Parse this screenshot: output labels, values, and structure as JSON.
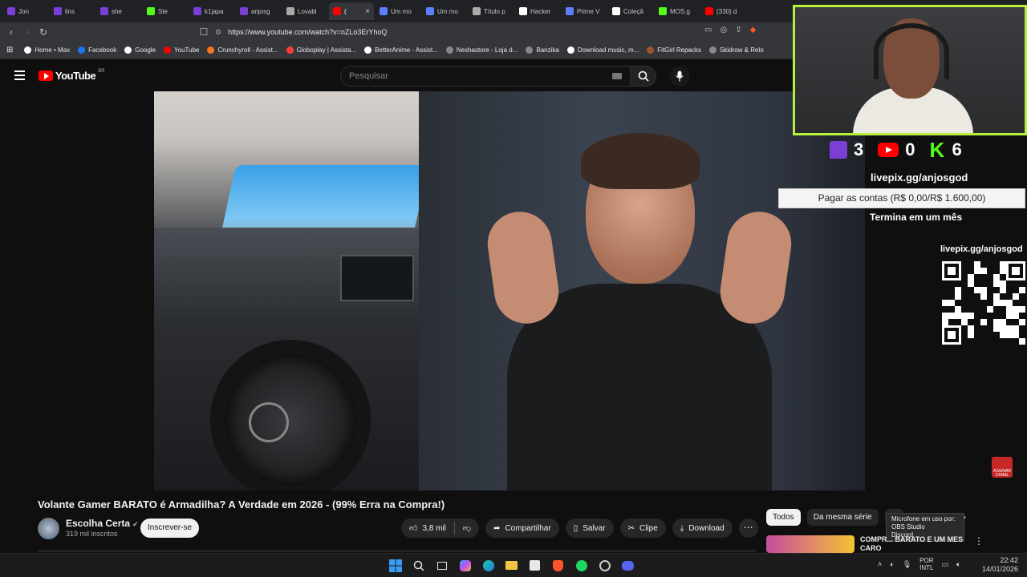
{
  "browser": {
    "tabs": [
      {
        "label": "Jon",
        "color": "#7b3fd6",
        "active": false
      },
      {
        "label": "lins",
        "color": "#7b3fd6",
        "active": false
      },
      {
        "label": "she",
        "color": "#7b3fd6",
        "active": false
      },
      {
        "label": "Ste",
        "color": "#53fc18",
        "active": false
      },
      {
        "label": "k1japa",
        "color": "#7b3fd6",
        "active": false
      },
      {
        "label": "anjosg",
        "color": "#7b3fd6",
        "active": false
      },
      {
        "label": "Lovabl",
        "color": "#aaaaaa",
        "active": false
      },
      {
        "label": "(",
        "color": "#ff0000",
        "active": true
      },
      {
        "label": "Um mo",
        "color": "#5b7fff",
        "active": false
      },
      {
        "label": "Um mo",
        "color": "#5b7fff",
        "active": false
      },
      {
        "label": "Título p",
        "color": "#aaaaaa",
        "active": false
      },
      {
        "label": "Hacker",
        "color": "#ffffff",
        "active": false
      },
      {
        "label": "Prime V",
        "color": "#5b7fff",
        "active": false
      },
      {
        "label": "Coleçã",
        "color": "#ffffff",
        "active": false
      },
      {
        "label": "MOS.g",
        "color": "#53fc18",
        "active": false
      },
      {
        "label": "(330) d",
        "color": "#ff0000",
        "active": false
      }
    ],
    "url": "https://www.youtube.com/watch?v=nZLo3ErYhoQ",
    "bookmarks": [
      {
        "label": "Home • Max",
        "color": "#ffffff"
      },
      {
        "label": "Facebook",
        "color": "#1877f2"
      },
      {
        "label": "Google",
        "color": "#ffffff"
      },
      {
        "label": "YouTube",
        "color": "#ff0000"
      },
      {
        "label": "Crunchyroll - Assist...",
        "color": "#f47521"
      },
      {
        "label": "Globoplay | Assista...",
        "color": "#ff3b3b"
      },
      {
        "label": "BetterAnime - Assist...",
        "color": "#ffffff"
      },
      {
        "label": "Neshastore - Loja d...",
        "color": "#888888"
      },
      {
        "label": "Banzika",
        "color": "#888888"
      },
      {
        "label": "Download music, m...",
        "color": "#ffffff"
      },
      {
        "label": "FitGirl Repacks",
        "color": "#a0522d"
      },
      {
        "label": "Skidrow & Relo",
        "color": "#888888"
      }
    ]
  },
  "youtube": {
    "logo_text": "YouTube",
    "country_code": "BR",
    "search_placeholder": "Pesquisar",
    "video_title": "Volante Gamer BARATO é Armadilha? A Verdade em 2026 - (99% Erra na Compra!)",
    "channel_name": "Escolha Certa",
    "channel_subs": "319 mil inscritos",
    "subscribe_label": "Inscrever-se",
    "likes": "3,8 mil",
    "share_label": "Compartilhar",
    "save_label": "Salvar",
    "clip_label": "Clipe",
    "download_label": "Download",
    "chips": [
      "Todos",
      "Da mesma série",
      "D"
    ],
    "recommendation_title": "COMPR... BARATO E UM MES CARO",
    "mic_tooltip_lines": [
      "Microfone em uso por:",
      "OBS Studio",
      "Discord"
    ]
  },
  "overlay": {
    "counters": [
      {
        "platform": "twitch",
        "value": "3"
      },
      {
        "platform": "youtube",
        "value": "0"
      },
      {
        "platform": "kick",
        "value": "6"
      }
    ],
    "livepix_handle": "livepix.gg/anjosgod",
    "goal_text": "Pagar as contas (R$ 0,00/R$ 1.600,00)",
    "goal_progress": 0.0,
    "goal_end": "Termina em um mês",
    "qr_label": "livepix.gg/anjosgod",
    "subscribe_badge": "ASSINAR CANAL"
  },
  "taskbar": {
    "lang_top": "POR",
    "lang_bottom": "INTL",
    "time": "22:42",
    "date": "14/01/2026"
  }
}
